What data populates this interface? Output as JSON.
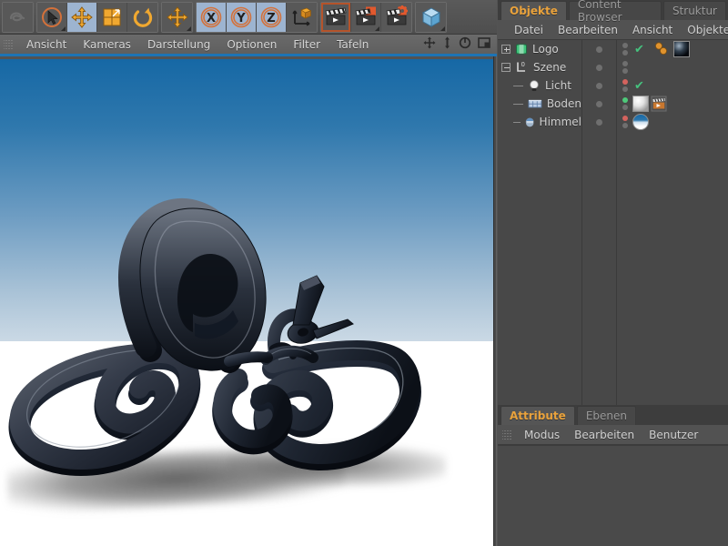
{
  "toolbar": {
    "groups": [
      {
        "name": "history",
        "buttons": [
          {
            "name": "undo-redo-button",
            "icon": "undo-loop-icon",
            "state": "disabled",
            "label": "Rückgängig"
          }
        ]
      },
      {
        "name": "tools",
        "buttons": [
          {
            "name": "selection-tool-button",
            "icon": "live-selection-icon",
            "state": "normal",
            "label": "Auswahl",
            "has_corner": true
          },
          {
            "name": "move-tool-button",
            "icon": "move-arrows-icon",
            "state": "selected",
            "label": "Bewegen"
          },
          {
            "name": "scale-tool-button",
            "icon": "scale-box-icon",
            "state": "normal",
            "label": "Skalieren"
          },
          {
            "name": "rotate-tool-button",
            "icon": "rotate-arc-icon",
            "state": "normal",
            "label": "Drehen"
          }
        ]
      },
      {
        "name": "axis",
        "buttons": [
          {
            "name": "move-axis-button",
            "icon": "move-arrows-icon",
            "state": "normal",
            "label": "Achse bewegen",
            "has_corner": true
          }
        ]
      },
      {
        "name": "axis-lock",
        "buttons": [
          {
            "name": "lock-x-axis-button",
            "icon": "x-axis-icon",
            "state": "selected",
            "label": "X"
          },
          {
            "name": "lock-y-axis-button",
            "icon": "y-axis-icon",
            "state": "selected",
            "label": "Y"
          },
          {
            "name": "lock-z-axis-button",
            "icon": "z-axis-icon",
            "state": "selected",
            "label": "Z"
          },
          {
            "name": "world-object-coordinates-button",
            "icon": "world-axis-cube-icon",
            "state": "normal",
            "label": "Welt/Objekt"
          }
        ]
      },
      {
        "name": "render",
        "buttons": [
          {
            "name": "render-view-button",
            "icon": "clapperboard-icon",
            "state": "outlined",
            "label": "Ansicht rendern"
          },
          {
            "name": "render-to-picture-viewer-button",
            "icon": "clapperboard-picture-icon",
            "state": "normal",
            "label": "In Bild-Manager rendern",
            "has_corner": true
          },
          {
            "name": "render-settings-button",
            "icon": "clapperboard-gear-icon",
            "state": "normal",
            "label": "Rendervoreinstellungen"
          }
        ]
      },
      {
        "name": "primitives",
        "buttons": [
          {
            "name": "add-cube-button",
            "icon": "blue-cube-icon",
            "state": "normal",
            "label": "Würfel",
            "has_corner": true
          }
        ]
      }
    ]
  },
  "viewport": {
    "menu": [
      "Ansicht",
      "Kameras",
      "Darstellung",
      "Optionen",
      "Filter",
      "Tafeln"
    ],
    "nav_icons": [
      "pan-icon",
      "dolly-icon",
      "rotate-icon",
      "maximize-icon"
    ],
    "active_border_color": "#1d74b5",
    "sky_top_color": "#1668a5",
    "sky_bottom_color": "#ffffff",
    "floor_color": "#ffffff",
    "object_color": "#1c2433",
    "scene_object": "3D-Schmetterling-Logo"
  },
  "object_manager": {
    "tabs": [
      {
        "name": "tab-objekte",
        "label": "Objekte",
        "active": true
      },
      {
        "name": "tab-content-browser",
        "label": "Content Browser",
        "active": false
      },
      {
        "name": "tab-struktur",
        "label": "Struktur",
        "active": false
      }
    ],
    "menu": [
      "Datei",
      "Bearbeiten",
      "Ansicht",
      "Objekte"
    ],
    "rows": [
      {
        "name": "Logo",
        "icon": "extrude-nurbs-icon",
        "depth": 0,
        "expander": "plus",
        "editor_dot": "#6f6f6f",
        "render_dot_top": "#6f6f6f",
        "render_dot_bottom": "#6f6f6f",
        "checkmark": true,
        "tags": [
          "phong-tag",
          "material-dark-tag"
        ]
      },
      {
        "name": "Szene",
        "icon": "null-object-icon",
        "depth": 0,
        "expander": "minus",
        "editor_dot": "#6f6f6f",
        "render_dot_top": "#6f6f6f",
        "render_dot_bottom": "#6f6f6f",
        "checkmark": false,
        "tags": []
      },
      {
        "name": "Licht",
        "icon": "light-icon",
        "depth": 1,
        "expander": "none",
        "editor_dot": "#6f6f6f",
        "render_dot_top": "#d4635e",
        "render_dot_bottom": "#6f6f6f",
        "checkmark": true,
        "tags": []
      },
      {
        "name": "Boden",
        "icon": "floor-icon",
        "depth": 1,
        "expander": "none",
        "editor_dot": "#6f6f6f",
        "render_dot_top": "#4ec97a",
        "render_dot_bottom": "#6f6f6f",
        "checkmark": false,
        "tags": [
          "material-white-tag",
          "compositing-tag"
        ]
      },
      {
        "name": "Himmel",
        "icon": "sky-icon",
        "depth": 1,
        "expander": "none",
        "editor_dot": "#6f6f6f",
        "render_dot_top": "#d4635e",
        "render_dot_bottom": "#6f6f6f",
        "checkmark": false,
        "tags": [
          "material-sky-tag"
        ]
      }
    ]
  },
  "attribute_manager": {
    "tabs": [
      {
        "name": "tab-attribute",
        "label": "Attribute",
        "active": true
      },
      {
        "name": "tab-ebenen",
        "label": "Ebenen",
        "active": false
      }
    ],
    "menu": [
      "Modus",
      "Bearbeiten",
      "Benutzer"
    ]
  },
  "theme": {
    "accent_orange": "#e9a23c",
    "panel_bg": "#4a4a4a",
    "toolbar_bg": "#555555",
    "selected_blue": "#9db4d0",
    "text": "#cfcfcf"
  }
}
